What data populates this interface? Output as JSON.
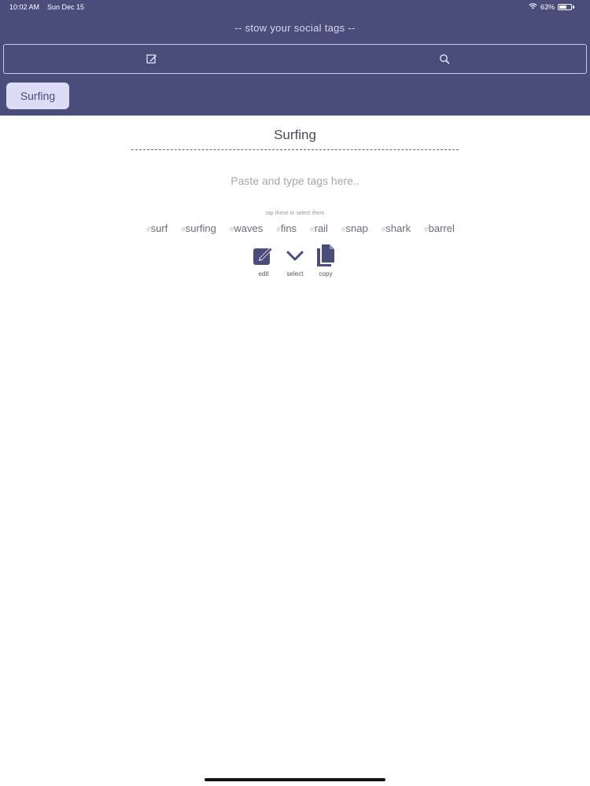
{
  "status_bar": {
    "time": "10:02 AM",
    "date": "Sun Dec 15",
    "battery_percent": "63%",
    "battery_level": 0.63,
    "wifi_icon": "wifi-icon"
  },
  "header": {
    "tagline": "-- stow your social tags --",
    "toolbar": {
      "edit_icon": "edit-icon",
      "search_icon": "search-icon"
    },
    "categories": [
      {
        "label": "Surfing",
        "selected": true
      }
    ]
  },
  "main": {
    "title": "Surfing",
    "input": {
      "placeholder": "Paste and type tags here..",
      "value": ""
    },
    "hint": "tap these to select them",
    "tags": [
      {
        "hash": "#",
        "text": "surf"
      },
      {
        "hash": "#",
        "text": "surfing"
      },
      {
        "hash": "#",
        "text": "waves"
      },
      {
        "hash": "#",
        "text": "fins"
      },
      {
        "hash": "#",
        "text": "rail"
      },
      {
        "hash": "#",
        "text": "snap"
      },
      {
        "hash": "#",
        "text": "shark"
      },
      {
        "hash": "#",
        "text": "barrel"
      }
    ],
    "actions": [
      {
        "icon": "edit-icon",
        "label": "edit"
      },
      {
        "icon": "chevron-down-icon",
        "label": "select"
      },
      {
        "icon": "copy-icon",
        "label": "copy"
      }
    ]
  },
  "colors": {
    "header_bg": "#4a4c7a",
    "pill_bg": "#dcdcf6",
    "accent_dark": "#4a4c7a"
  }
}
